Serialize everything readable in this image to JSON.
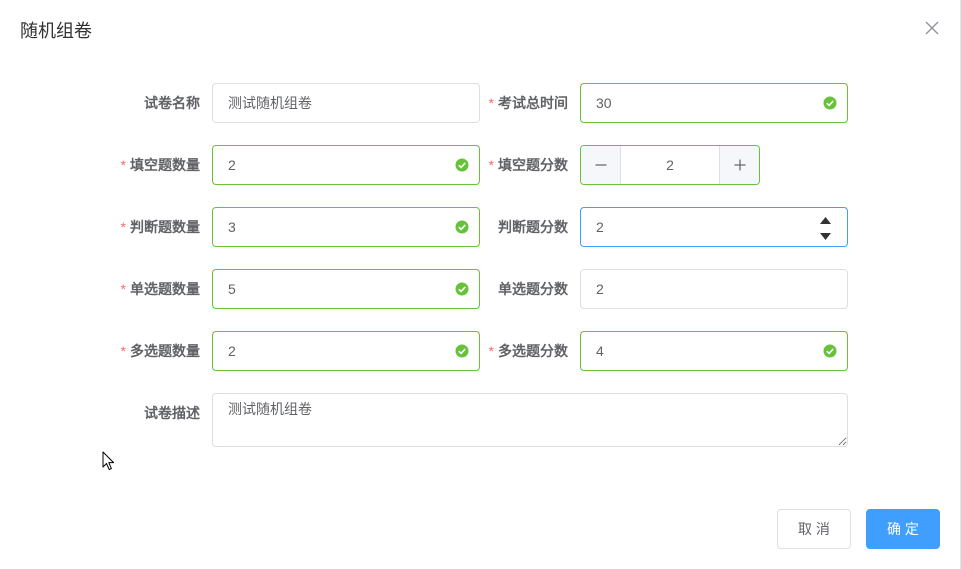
{
  "dialog": {
    "title": "随机组卷",
    "close_icon": "close-icon"
  },
  "form": {
    "required_mark": "*",
    "paper_name": {
      "label": "试卷名称",
      "value": "测试随机组卷",
      "required": false
    },
    "exam_total_time": {
      "label": "考试总时间",
      "value": "30",
      "required": true,
      "validation": "success"
    },
    "fill_blank_count": {
      "label": "填空题数量",
      "value": "2",
      "required": true,
      "validation": "success"
    },
    "fill_blank_score": {
      "label": "填空题分数",
      "value": "2",
      "required": true,
      "validation": "success",
      "decrease_icon": "minus-icon",
      "increase_icon": "plus-icon"
    },
    "judge_count": {
      "label": "判断题数量",
      "value": "3",
      "required": true,
      "validation": "success"
    },
    "judge_score": {
      "label": "判断题分数",
      "value": "2",
      "required": false,
      "focused": true,
      "spinner_icons": [
        "spin-up-icon",
        "spin-down-icon"
      ]
    },
    "single_choice_count": {
      "label": "单选题数量",
      "value": "5",
      "required": true,
      "validation": "success"
    },
    "single_choice_score": {
      "label": "单选题分数",
      "value": "2",
      "required": false
    },
    "multi_choice_count": {
      "label": "多选题数量",
      "value": "2",
      "required": true,
      "validation": "success"
    },
    "multi_choice_score": {
      "label": "多选题分数",
      "value": "4",
      "required": true,
      "validation": "success"
    },
    "description": {
      "label": "试卷描述",
      "value": "测试随机组卷"
    }
  },
  "footer": {
    "cancel_label": "取 消",
    "confirm_label": "确 定"
  },
  "colors": {
    "primary": "#409EFF",
    "success": "#67C23A",
    "required": "#F56C6C",
    "text": "#606266",
    "title": "#303133",
    "border": "#DCDFE6"
  }
}
